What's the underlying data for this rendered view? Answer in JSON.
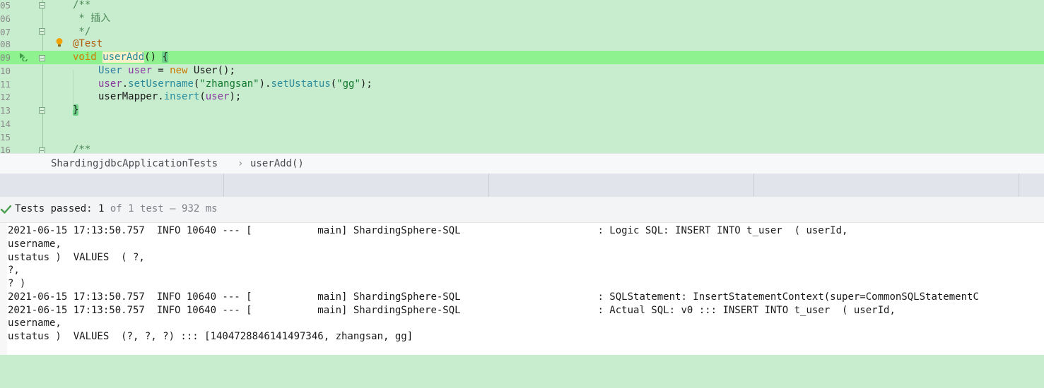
{
  "editor": {
    "line_numbers": [
      "05",
      "06",
      "07",
      "08",
      "09",
      "10",
      "11",
      "12",
      "13",
      "14",
      "15",
      "16"
    ],
    "lines": {
      "l05": "/**",
      "l06": " * 插入",
      "l07": " */",
      "l08": "@Test",
      "l09_kw": "void",
      "l09_m": "userAdd",
      "l09_rest": "() ",
      "l09_brace": "{",
      "l10_type": "User",
      "l10_var": "user",
      "l10_eq": " = ",
      "l10_new": "new",
      "l10_rest": " User();",
      "l11_var": "user",
      "l11_dot": ".",
      "l11_m1": "setUsername",
      "l11_p1": "(",
      "l11_s1": "\"zhangsan\"",
      "l11_p2": ").",
      "l11_m2": "setUstatus",
      "l11_p3": "(",
      "l11_s2": "\"gg\"",
      "l11_p4": ");",
      "l12_obj": "userMapper",
      "l12_dot": ".",
      "l12_m": "insert",
      "l12_p1": "(",
      "l12_var": "user",
      "l12_p2": ");",
      "l13": "}",
      "l16": "/**"
    },
    "icons": [
      "fold-icon",
      "bulb-icon",
      "run-test-icon"
    ]
  },
  "breadcrumb": {
    "class_name": "ShardingjdbcApplicationTests",
    "separator": "›",
    "method": "userAdd()"
  },
  "status": {
    "label": "Tests passed: ",
    "passed": "1",
    "rest": " of 1 test – 932 ms",
    "icon": "check-icon",
    "color": "#4a9e4f"
  },
  "console": {
    "lines": [
      "2021-06-15 17:13:50.757  INFO 10640 --- [           main] ShardingSphere-SQL                       : Logic SQL: INSERT INTO t_user  ( userId,",
      "username,",
      "ustatus )  VALUES  ( ?,",
      "?,",
      "? )",
      "2021-06-15 17:13:50.757  INFO 10640 --- [           main] ShardingSphere-SQL                       : SQLStatement: InsertStatementContext(super=CommonSQLStatementC",
      "2021-06-15 17:13:50.757  INFO 10640 --- [           main] ShardingSphere-SQL                       : Actual SQL: v0 ::: INSERT INTO t_user  ( userId,",
      "username,",
      "ustatus )  VALUES  (?, ?, ?) ::: [1404728846141497346, zhangsan, gg]"
    ]
  }
}
